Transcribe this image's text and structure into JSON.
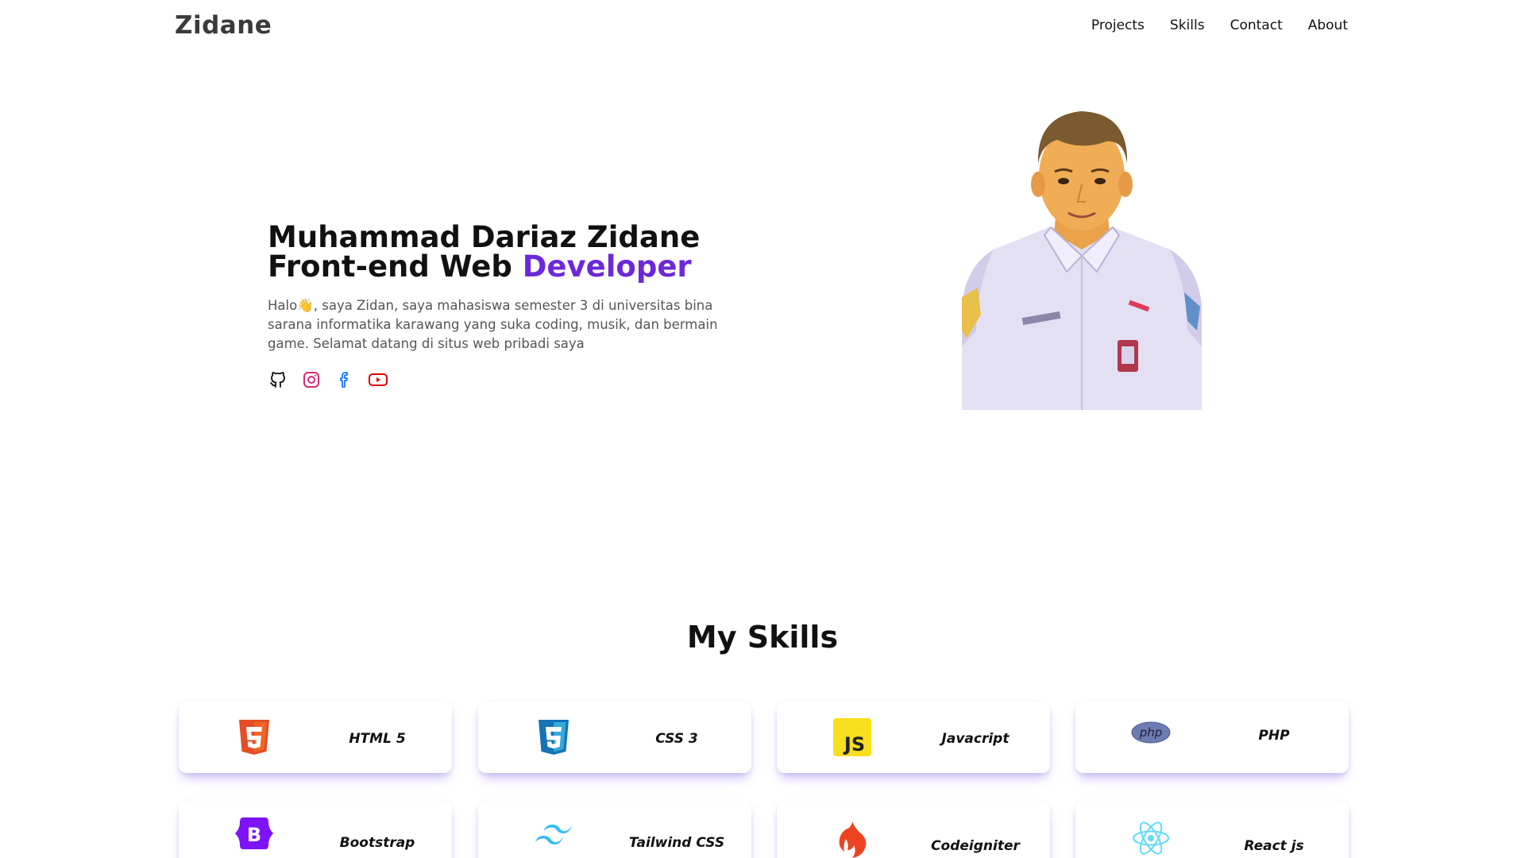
{
  "navbar": {
    "brand": "Zidane",
    "links": [
      "Projects",
      "Skills",
      "Contact",
      "About"
    ]
  },
  "hero": {
    "name": "Muhammad Dariaz Zidane",
    "role_prefix": "Front-end Web ",
    "role_accent": "Developer",
    "description": "Halo👋, saya Zidan, saya mahasiswa semester 3 di universitas bina sarana informatika karawang yang suka coding, musik, dan bermain game. Selamat datang di situs web pribadi saya",
    "socials": [
      "github-icon",
      "instagram-icon",
      "facebook-icon",
      "youtube-icon"
    ]
  },
  "skills": {
    "title": "My Skills",
    "items": [
      {
        "label": "HTML 5",
        "icon": "html5-icon"
      },
      {
        "label": "CSS 3",
        "icon": "css3-icon"
      },
      {
        "label": "Javacript",
        "icon": "javascript-icon"
      },
      {
        "label": "PHP",
        "icon": "php-icon"
      },
      {
        "label": "Bootstrap",
        "icon": "bootstrap-icon"
      },
      {
        "label": "Tailwind CSS",
        "icon": "tailwind-icon"
      },
      {
        "label": "Codeigniter",
        "icon": "codeigniter-icon"
      },
      {
        "label": "React js",
        "icon": "react-icon"
      }
    ]
  },
  "colors": {
    "accent": "#6d28d9",
    "card_shadow": "#a78bfa"
  }
}
